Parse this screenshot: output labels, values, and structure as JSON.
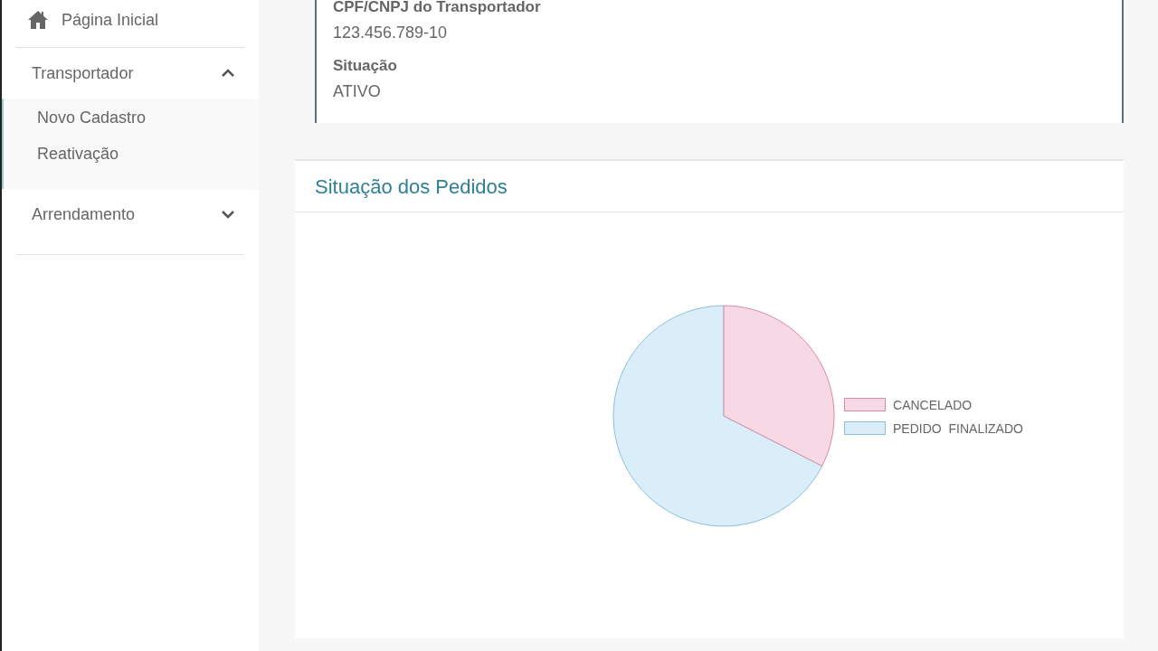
{
  "sidebar": {
    "items": [
      {
        "label": "Página Inicial",
        "kind": "link"
      },
      {
        "label": "Transportador",
        "kind": "group",
        "expanded": true,
        "children": [
          {
            "label": "Novo Cadastro"
          },
          {
            "label": "Reativação"
          }
        ]
      },
      {
        "label": "Arrendamento",
        "kind": "group",
        "expanded": false
      }
    ]
  },
  "details": {
    "fields": [
      {
        "label": "CPF/CNPJ do Transportador",
        "value": "123.456.789-10"
      },
      {
        "label": "Situação",
        "value": "ATIVO"
      }
    ]
  },
  "orders_panel": {
    "title": "Situação dos Pedidos",
    "legend": [
      {
        "label": "CANCELADO",
        "color": "#f7d9e6"
      },
      {
        "label": "PEDIDO  FINALIZADO",
        "color": "#d9eef8"
      }
    ]
  }
}
